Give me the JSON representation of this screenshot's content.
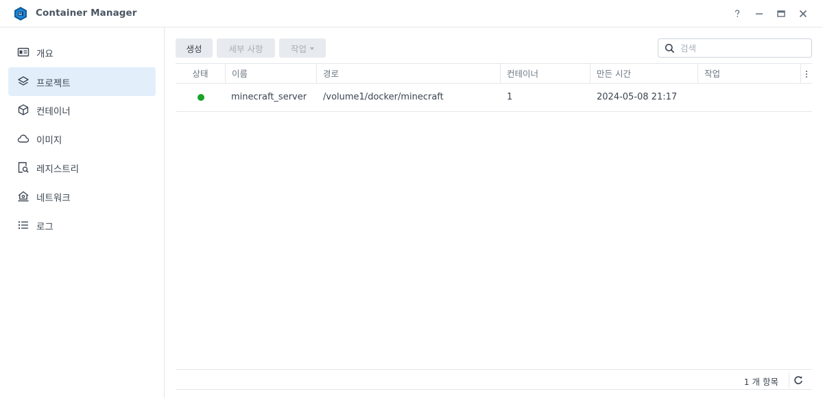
{
  "window": {
    "title": "Container Manager",
    "controls": [
      "help",
      "minimize",
      "maximize",
      "close"
    ]
  },
  "sidebar": {
    "items": [
      {
        "label": "개요",
        "icon": "overview-icon",
        "active": false
      },
      {
        "label": "프로젝트",
        "icon": "layers-icon",
        "active": true
      },
      {
        "label": "컨테이너",
        "icon": "cube-icon",
        "active": false
      },
      {
        "label": "이미지",
        "icon": "cloud-icon",
        "active": false
      },
      {
        "label": "레지스트리",
        "icon": "registry-search-icon",
        "active": false
      },
      {
        "label": "네트워크",
        "icon": "network-home-icon",
        "active": false
      },
      {
        "label": "로그",
        "icon": "list-icon",
        "active": false
      }
    ]
  },
  "toolbar": {
    "create_label": "생성",
    "details_label": "세부 사항",
    "action_label": "작업",
    "search_placeholder": "검색"
  },
  "table": {
    "columns": [
      "상태",
      "이름",
      "경로",
      "컨테이너",
      "만든 시간",
      "작업"
    ],
    "rows": [
      {
        "status": "running",
        "status_color": "#1aa226",
        "name": "minecraft_server",
        "path": "/volume1/docker/minecraft",
        "containers": "1",
        "created": "2024-05-08 21:17",
        "action": ""
      }
    ]
  },
  "footer": {
    "item_count": "1 개 항목"
  },
  "colors": {
    "accent": "#0a7ad4",
    "active_nav_bg": "#e2effb",
    "button_bg": "#e7eaee"
  }
}
